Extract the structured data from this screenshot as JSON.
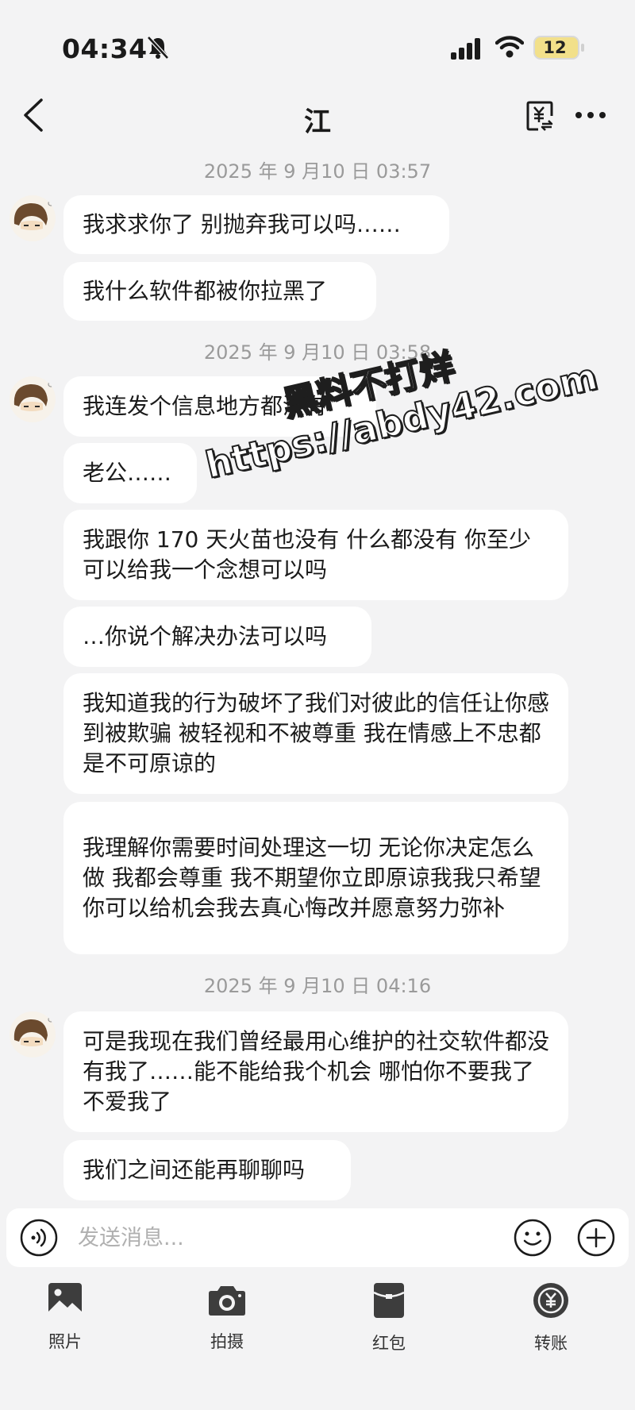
{
  "status_bar": {
    "time": "04:34",
    "battery": "12"
  },
  "header": {
    "title": "江"
  },
  "messages": [
    {
      "time": "2025 年 9 月10 日 03:57",
      "bubbles": [
        "我求求你了 别抛弃我可以吗……",
        "我什么软件都被你拉黑了"
      ]
    },
    {
      "time": "2025 年 9 月10 日 03:58",
      "bubbles": [
        "我连发个信息地方都没有",
        "老公……",
        "我跟你 170 天火苗也没有 什么都没有 你至少可以给我一个念想可以吗",
        "…你说个解决办法可以吗",
        "我知道我的行为破坏了我们对彼此的信任让你感到被欺骗 被轻视和不被尊重 我在情感上不忠都是不可原谅的",
        "我理解你需要时间处理这一切 无论你决定怎么做 我都会尊重 我不期望你立即原谅我我只希望你可以给机会我去真心悔改并愿意努力弥补"
      ]
    },
    {
      "time": "2025 年 9 月10 日 04:16",
      "bubbles": [
        "可是我现在我们曾经最用心维护的社交软件都没有我了……能不能给我个机会 哪怕你不要我了不爱我了",
        "我们之间还能再聊聊吗"
      ]
    }
  ],
  "watermark": {
    "line1": "黑料不打烊",
    "line2": "https://abdy42.com"
  },
  "input": {
    "placeholder": "发送消息..."
  },
  "toolbar": {
    "photo": "照片",
    "camera": "拍摄",
    "red_packet": "红包",
    "transfer": "转账"
  },
  "colors": {
    "background": "#f3f3f4",
    "bubble": "#ffffff",
    "red_packet": "#e0473c"
  }
}
